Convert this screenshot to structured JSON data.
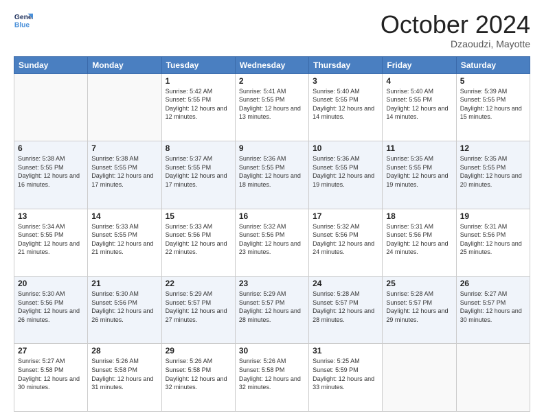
{
  "logo": {
    "line1": "General",
    "line2": "Blue"
  },
  "title": "October 2024",
  "location": "Dzaoudzi, Mayotte",
  "header_days": [
    "Sunday",
    "Monday",
    "Tuesday",
    "Wednesday",
    "Thursday",
    "Friday",
    "Saturday"
  ],
  "weeks": [
    [
      {
        "day": "",
        "sunrise": "",
        "sunset": "",
        "daylight": ""
      },
      {
        "day": "",
        "sunrise": "",
        "sunset": "",
        "daylight": ""
      },
      {
        "day": "1",
        "sunrise": "Sunrise: 5:42 AM",
        "sunset": "Sunset: 5:55 PM",
        "daylight": "Daylight: 12 hours and 12 minutes."
      },
      {
        "day": "2",
        "sunrise": "Sunrise: 5:41 AM",
        "sunset": "Sunset: 5:55 PM",
        "daylight": "Daylight: 12 hours and 13 minutes."
      },
      {
        "day": "3",
        "sunrise": "Sunrise: 5:40 AM",
        "sunset": "Sunset: 5:55 PM",
        "daylight": "Daylight: 12 hours and 14 minutes."
      },
      {
        "day": "4",
        "sunrise": "Sunrise: 5:40 AM",
        "sunset": "Sunset: 5:55 PM",
        "daylight": "Daylight: 12 hours and 14 minutes."
      },
      {
        "day": "5",
        "sunrise": "Sunrise: 5:39 AM",
        "sunset": "Sunset: 5:55 PM",
        "daylight": "Daylight: 12 hours and 15 minutes."
      }
    ],
    [
      {
        "day": "6",
        "sunrise": "Sunrise: 5:38 AM",
        "sunset": "Sunset: 5:55 PM",
        "daylight": "Daylight: 12 hours and 16 minutes."
      },
      {
        "day": "7",
        "sunrise": "Sunrise: 5:38 AM",
        "sunset": "Sunset: 5:55 PM",
        "daylight": "Daylight: 12 hours and 17 minutes."
      },
      {
        "day": "8",
        "sunrise": "Sunrise: 5:37 AM",
        "sunset": "Sunset: 5:55 PM",
        "daylight": "Daylight: 12 hours and 17 minutes."
      },
      {
        "day": "9",
        "sunrise": "Sunrise: 5:36 AM",
        "sunset": "Sunset: 5:55 PM",
        "daylight": "Daylight: 12 hours and 18 minutes."
      },
      {
        "day": "10",
        "sunrise": "Sunrise: 5:36 AM",
        "sunset": "Sunset: 5:55 PM",
        "daylight": "Daylight: 12 hours and 19 minutes."
      },
      {
        "day": "11",
        "sunrise": "Sunrise: 5:35 AM",
        "sunset": "Sunset: 5:55 PM",
        "daylight": "Daylight: 12 hours and 19 minutes."
      },
      {
        "day": "12",
        "sunrise": "Sunrise: 5:35 AM",
        "sunset": "Sunset: 5:55 PM",
        "daylight": "Daylight: 12 hours and 20 minutes."
      }
    ],
    [
      {
        "day": "13",
        "sunrise": "Sunrise: 5:34 AM",
        "sunset": "Sunset: 5:55 PM",
        "daylight": "Daylight: 12 hours and 21 minutes."
      },
      {
        "day": "14",
        "sunrise": "Sunrise: 5:33 AM",
        "sunset": "Sunset: 5:55 PM",
        "daylight": "Daylight: 12 hours and 21 minutes."
      },
      {
        "day": "15",
        "sunrise": "Sunrise: 5:33 AM",
        "sunset": "Sunset: 5:56 PM",
        "daylight": "Daylight: 12 hours and 22 minutes."
      },
      {
        "day": "16",
        "sunrise": "Sunrise: 5:32 AM",
        "sunset": "Sunset: 5:56 PM",
        "daylight": "Daylight: 12 hours and 23 minutes."
      },
      {
        "day": "17",
        "sunrise": "Sunrise: 5:32 AM",
        "sunset": "Sunset: 5:56 PM",
        "daylight": "Daylight: 12 hours and 24 minutes."
      },
      {
        "day": "18",
        "sunrise": "Sunrise: 5:31 AM",
        "sunset": "Sunset: 5:56 PM",
        "daylight": "Daylight: 12 hours and 24 minutes."
      },
      {
        "day": "19",
        "sunrise": "Sunrise: 5:31 AM",
        "sunset": "Sunset: 5:56 PM",
        "daylight": "Daylight: 12 hours and 25 minutes."
      }
    ],
    [
      {
        "day": "20",
        "sunrise": "Sunrise: 5:30 AM",
        "sunset": "Sunset: 5:56 PM",
        "daylight": "Daylight: 12 hours and 26 minutes."
      },
      {
        "day": "21",
        "sunrise": "Sunrise: 5:30 AM",
        "sunset": "Sunset: 5:56 PM",
        "daylight": "Daylight: 12 hours and 26 minutes."
      },
      {
        "day": "22",
        "sunrise": "Sunrise: 5:29 AM",
        "sunset": "Sunset: 5:57 PM",
        "daylight": "Daylight: 12 hours and 27 minutes."
      },
      {
        "day": "23",
        "sunrise": "Sunrise: 5:29 AM",
        "sunset": "Sunset: 5:57 PM",
        "daylight": "Daylight: 12 hours and 28 minutes."
      },
      {
        "day": "24",
        "sunrise": "Sunrise: 5:28 AM",
        "sunset": "Sunset: 5:57 PM",
        "daylight": "Daylight: 12 hours and 28 minutes."
      },
      {
        "day": "25",
        "sunrise": "Sunrise: 5:28 AM",
        "sunset": "Sunset: 5:57 PM",
        "daylight": "Daylight: 12 hours and 29 minutes."
      },
      {
        "day": "26",
        "sunrise": "Sunrise: 5:27 AM",
        "sunset": "Sunset: 5:57 PM",
        "daylight": "Daylight: 12 hours and 30 minutes."
      }
    ],
    [
      {
        "day": "27",
        "sunrise": "Sunrise: 5:27 AM",
        "sunset": "Sunset: 5:58 PM",
        "daylight": "Daylight: 12 hours and 30 minutes."
      },
      {
        "day": "28",
        "sunrise": "Sunrise: 5:26 AM",
        "sunset": "Sunset: 5:58 PM",
        "daylight": "Daylight: 12 hours and 31 minutes."
      },
      {
        "day": "29",
        "sunrise": "Sunrise: 5:26 AM",
        "sunset": "Sunset: 5:58 PM",
        "daylight": "Daylight: 12 hours and 32 minutes."
      },
      {
        "day": "30",
        "sunrise": "Sunrise: 5:26 AM",
        "sunset": "Sunset: 5:58 PM",
        "daylight": "Daylight: 12 hours and 32 minutes."
      },
      {
        "day": "31",
        "sunrise": "Sunrise: 5:25 AM",
        "sunset": "Sunset: 5:59 PM",
        "daylight": "Daylight: 12 hours and 33 minutes."
      },
      {
        "day": "",
        "sunrise": "",
        "sunset": "",
        "daylight": ""
      },
      {
        "day": "",
        "sunrise": "",
        "sunset": "",
        "daylight": ""
      }
    ]
  ]
}
